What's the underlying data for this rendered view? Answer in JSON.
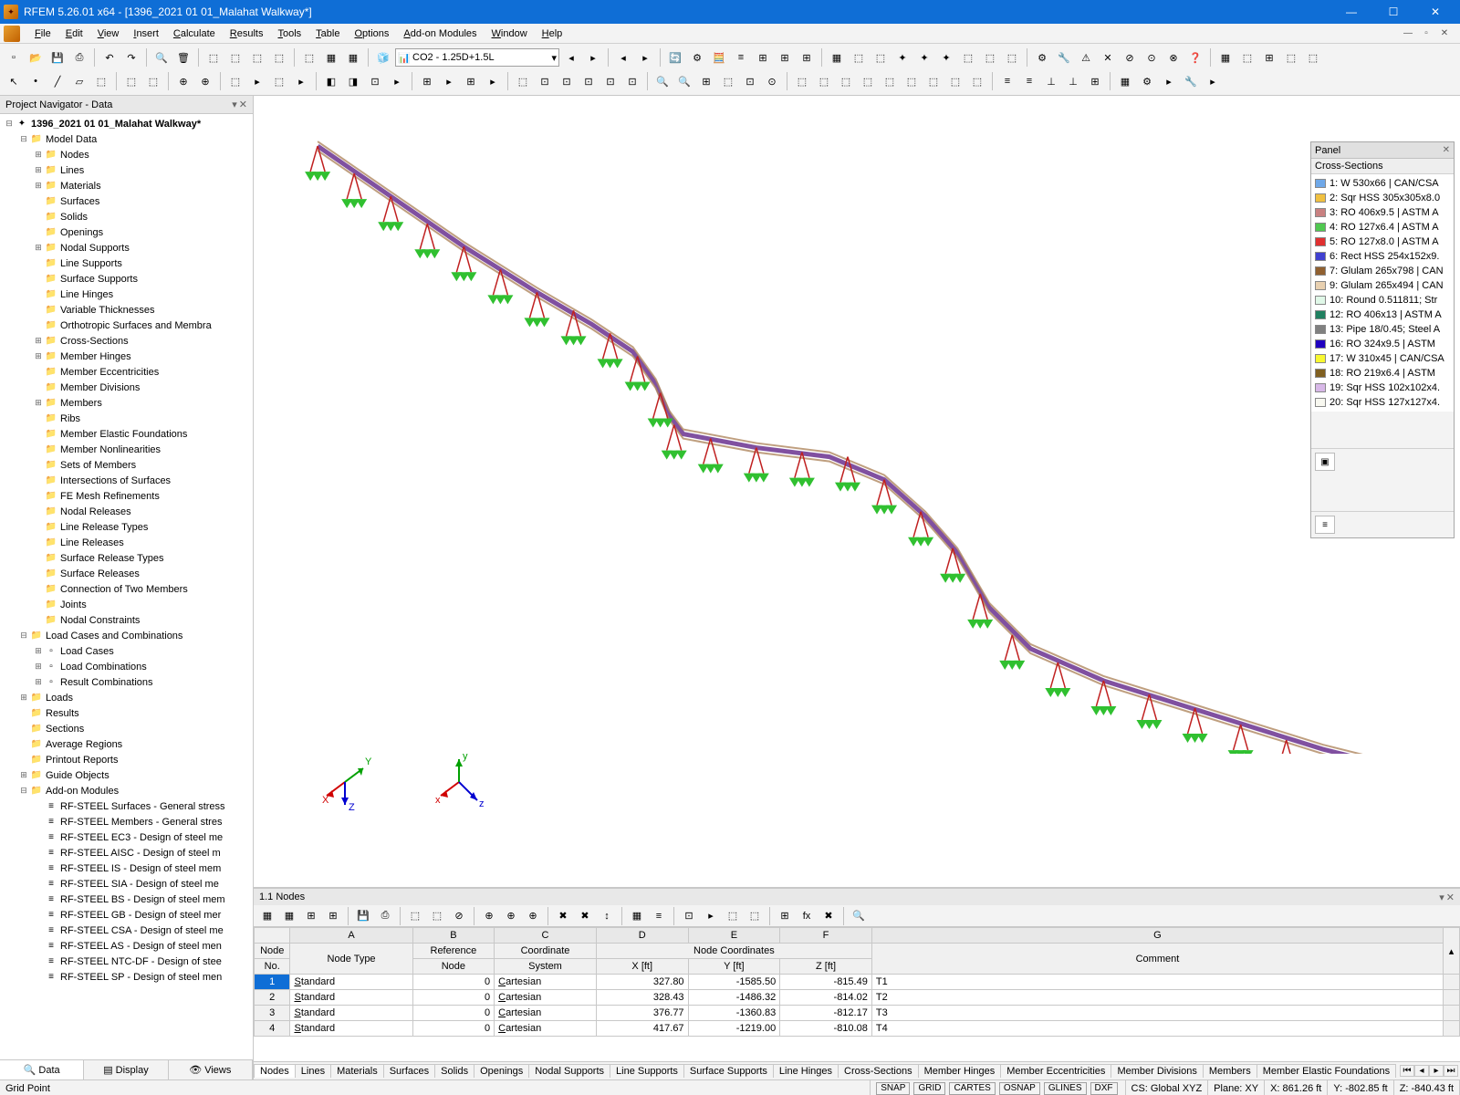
{
  "window": {
    "title": "RFEM 5.26.01 x64 - [1396_2021 01 01_Malahat Walkway*]"
  },
  "menu": [
    "File",
    "Edit",
    "View",
    "Insert",
    "Calculate",
    "Results",
    "Tools",
    "Table",
    "Options",
    "Add-on Modules",
    "Window",
    "Help"
  ],
  "load_combo": "CO2 - 1.25D+1.5L",
  "navigator": {
    "title": "Project Navigator - Data",
    "root": "1396_2021 01 01_Malahat Walkway*",
    "model_data": "Model Data",
    "model_items": [
      "Nodes",
      "Lines",
      "Materials",
      "Surfaces",
      "Solids",
      "Openings",
      "Nodal Supports",
      "Line Supports",
      "Surface Supports",
      "Line Hinges",
      "Variable Thicknesses",
      "Orthotropic Surfaces and Membra",
      "Cross-Sections",
      "Member Hinges",
      "Member Eccentricities",
      "Member Divisions",
      "Members",
      "Ribs",
      "Member Elastic Foundations",
      "Member Nonlinearities",
      "Sets of Members",
      "Intersections of Surfaces",
      "FE Mesh Refinements",
      "Nodal Releases",
      "Line Release Types",
      "Line Releases",
      "Surface Release Types",
      "Surface Releases",
      "Connection of Two Members",
      "Joints",
      "Nodal Constraints"
    ],
    "lcc": "Load Cases and Combinations",
    "lcc_items": [
      "Load Cases",
      "Load Combinations",
      "Result Combinations"
    ],
    "after": [
      "Loads",
      "Results",
      "Sections",
      "Average Regions",
      "Printout Reports",
      "Guide Objects",
      "Add-on Modules"
    ],
    "addon_items": [
      "RF-STEEL Surfaces - General stress",
      "RF-STEEL Members - General stres",
      "RF-STEEL EC3 - Design of steel me",
      "RF-STEEL AISC - Design of steel m",
      "RF-STEEL IS - Design of steel mem",
      "RF-STEEL SIA - Design of steel me",
      "RF-STEEL BS - Design of steel mem",
      "RF-STEEL GB - Design of steel mer",
      "RF-STEEL CSA - Design of steel me",
      "RF-STEEL AS - Design of steel men",
      "RF-STEEL NTC-DF - Design of stee",
      "RF-STEEL SP - Design of steel men"
    ],
    "tabs": [
      "Data",
      "Display",
      "Views"
    ]
  },
  "panel": {
    "title": "Panel",
    "subtitle": "Cross-Sections",
    "legend": [
      {
        "c": "#6fa8e8",
        "t": "1: W 530x66 | CAN/CSA"
      },
      {
        "c": "#f0c040",
        "t": "2: Sqr HSS 305x305x8.0"
      },
      {
        "c": "#c88080",
        "t": "3: RO 406x9.5 | ASTM A"
      },
      {
        "c": "#50c850",
        "t": "4: RO 127x6.4 | ASTM A"
      },
      {
        "c": "#e03030",
        "t": "5: RO 127x8.0 | ASTM A"
      },
      {
        "c": "#4040d0",
        "t": "6: Rect HSS 254x152x9."
      },
      {
        "c": "#906030",
        "t": "7: Glulam 265x798 | CAN"
      },
      {
        "c": "#e8d0b0",
        "t": "9: Glulam 265x494 | CAN"
      },
      {
        "c": "#e0f8e8",
        "t": "10: Round 0.511811; Str"
      },
      {
        "c": "#208060",
        "t": "12: RO 406x13 | ASTM A"
      },
      {
        "c": "#808080",
        "t": "13: Pipe 18/0.45; Steel A"
      },
      {
        "c": "#2000c0",
        "t": "16: RO 324x9.5 | ASTM"
      },
      {
        "c": "#f8f830",
        "t": "17: W 310x45 | CAN/CSA"
      },
      {
        "c": "#806020",
        "t": "18: RO 219x6.4 | ASTM"
      },
      {
        "c": "#d8b8e8",
        "t": "19: Sqr HSS 102x102x4."
      },
      {
        "c": "#f8f8f0",
        "t": "20: Sqr HSS 127x127x4."
      }
    ]
  },
  "table": {
    "title": "1.1 Nodes",
    "top_cols": [
      "A",
      "B",
      "C",
      "D",
      "E",
      "F",
      "G"
    ],
    "group_coord": "Node Coordinates",
    "headers_row1": [
      "Node",
      "Reference",
      "Coordinate"
    ],
    "headers_row2": [
      "No.",
      "Node Type",
      "Node",
      "System",
      "X [ft]",
      "Y [ft]",
      "Z [ft]",
      "Comment"
    ],
    "rows": [
      {
        "n": "1",
        "type": "Standard",
        "ref": "0",
        "sys": "Cartesian",
        "x": "327.80",
        "y": "-1585.50",
        "z": "-815.49",
        "c": "T1"
      },
      {
        "n": "2",
        "type": "Standard",
        "ref": "0",
        "sys": "Cartesian",
        "x": "328.43",
        "y": "-1486.32",
        "z": "-814.02",
        "c": "T2"
      },
      {
        "n": "3",
        "type": "Standard",
        "ref": "0",
        "sys": "Cartesian",
        "x": "376.77",
        "y": "-1360.83",
        "z": "-812.17",
        "c": "T3"
      },
      {
        "n": "4",
        "type": "Standard",
        "ref": "0",
        "sys": "Cartesian",
        "x": "417.67",
        "y": "-1219.00",
        "z": "-810.08",
        "c": "T4"
      }
    ],
    "tabs": [
      "Nodes",
      "Lines",
      "Materials",
      "Surfaces",
      "Solids",
      "Openings",
      "Nodal Supports",
      "Line Supports",
      "Surface Supports",
      "Line Hinges",
      "Cross-Sections",
      "Member Hinges",
      "Member Eccentricities",
      "Member Divisions",
      "Members",
      "Member Elastic Foundations"
    ]
  },
  "status": {
    "left": "Grid Point",
    "snaps": [
      "SNAP",
      "GRID",
      "CARTES",
      "OSNAP",
      "GLINES",
      "DXF"
    ],
    "cs": "CS: Global XYZ",
    "plane": "Plane: XY",
    "x": "X: 861.26 ft",
    "y": "Y: -802.85 ft",
    "z": "Z: -840.43 ft"
  }
}
